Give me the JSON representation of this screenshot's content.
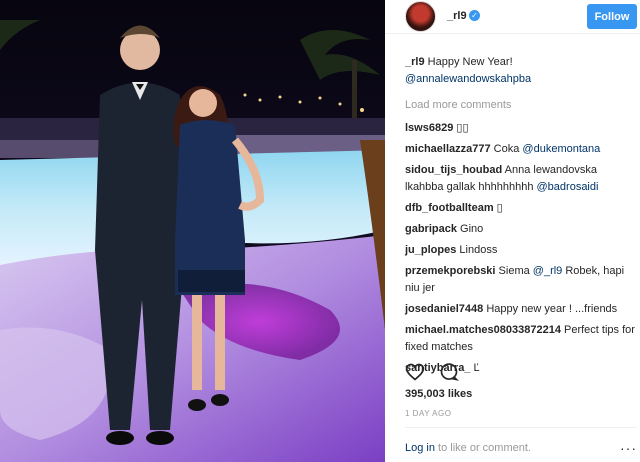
{
  "post": {
    "username": "_rl9",
    "verified_icon": "verified-badge-icon",
    "follow_label": "Follow",
    "caption_user": "_rl9",
    "caption_text": "Happy New Year!",
    "caption_mention": "@annalewandowskahpba",
    "load_more": "Load more comments",
    "likes": "395,003 likes",
    "date": "1 DAY AGO",
    "login_link": "Log in",
    "login_suffix": " to like or comment.",
    "more_icon": "···"
  },
  "comments": [
    {
      "user": "lsws6829",
      "text": " ▯▯",
      "mention": ""
    },
    {
      "user": "michaellazza777",
      "text": " Coka ",
      "mention": "@dukemontana"
    },
    {
      "user": "sidou_tijs_houbad",
      "text": " Anna lewandovska lkahbba gallak hhhhhhhhh ",
      "mention": "@badrosaidi"
    },
    {
      "user": "dfb_footballteam",
      "text": " ▯",
      "mention": ""
    },
    {
      "user": "gabripack",
      "text": " Gino",
      "mention": ""
    },
    {
      "user": "ju_plopes",
      "text": " Lindoss",
      "mention": ""
    },
    {
      "user": "przemekporebski",
      "text": " Siema ",
      "mention": "@_rl9",
      "text2": " Robek, hapi niu jer"
    },
    {
      "user": "josedaniel7448",
      "text": " Happy new year ! ...friends",
      "mention": ""
    },
    {
      "user": "michael.matches08033872214",
      "text": " Perfect tips for fixed matches",
      "mention": ""
    },
    {
      "user": "santiybarra_",
      "text": " Ľ",
      "mention": ""
    }
  ],
  "colors": {
    "accent": "#3897f0",
    "mention": "#003569",
    "muted": "#999999"
  },
  "icons": [
    "heart-icon",
    "comment-icon",
    "more-options-icon"
  ]
}
